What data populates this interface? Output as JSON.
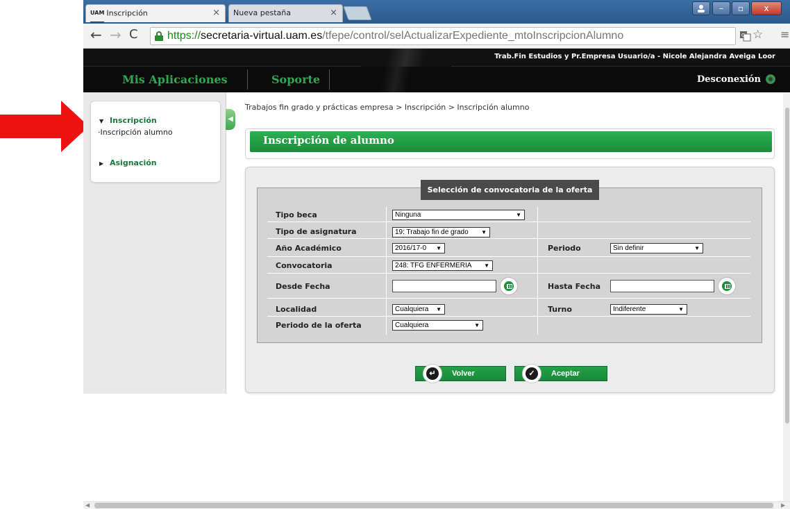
{
  "browser": {
    "tabs": [
      {
        "favicon": "UAM",
        "label": "Inscripción",
        "active": true
      },
      {
        "label": "Nueva pestaña",
        "active": false
      }
    ],
    "url": {
      "protocol": "https://",
      "host": "secretaria-virtual.uam.es",
      "path": "/tfepe/control/selActualizarExpediente_mtoInscripcionAlumno"
    },
    "close_glyph": "×",
    "window_buttons": {
      "minimize": "–",
      "maximize": "▫",
      "close": "x"
    }
  },
  "header": {
    "info": "Trab.Fin Estudios y Pr.Empresa  Usuario/a - Nicole Alejandra Aveiga Loor",
    "menu": {
      "apps": "Mis Aplicaciones",
      "support": "Soporte"
    },
    "logout": "Desconexión"
  },
  "sidebar": {
    "groups": [
      {
        "label": "Inscripción",
        "expanded": true,
        "items": [
          "Inscripción alumno"
        ]
      },
      {
        "label": "Asignación",
        "expanded": false,
        "items": []
      }
    ],
    "bullet": "·"
  },
  "main": {
    "breadcrumb": "Trabajos fin grado y prácticas empresa > Inscripción > Inscripción alumno",
    "title": "Inscripción de alumno",
    "fieldset_legend": "Selección de convocatoria de la oferta",
    "fields": {
      "tipo_beca": {
        "label": "Tipo beca",
        "value": "Ninguna"
      },
      "tipo_asignatura": {
        "label": "Tipo de asignatura",
        "value": "19: Trabajo fin de grado"
      },
      "anio_academico": {
        "label": "Año Académico",
        "value": "2016/17-0"
      },
      "periodo": {
        "label": "Periodo",
        "value": "Sin definir"
      },
      "convocatoria": {
        "label": "Convocatoria",
        "value": "248: TFG ENFERMERIA"
      },
      "desde_fecha": {
        "label": "Desde Fecha",
        "value": ""
      },
      "hasta_fecha": {
        "label": "Hasta Fecha",
        "value": ""
      },
      "localidad": {
        "label": "Localidad",
        "value": "Cualquiera"
      },
      "turno": {
        "label": "Turno",
        "value": "Indiferente"
      },
      "periodo_oferta": {
        "label": "Periodo de la oferta",
        "value": "Cualquiera"
      }
    },
    "buttons": {
      "back": "Volver",
      "accept": "Aceptar"
    }
  },
  "colors": {
    "brand_green": "#1a8c3a",
    "annotation_red": "#ee1111",
    "header_black": "#0b0b0b"
  },
  "icons": [
    "back-icon",
    "forward-icon",
    "reload-icon",
    "lock-icon",
    "translate-icon",
    "star-icon",
    "menu-icon",
    "power-icon",
    "calendar-icon",
    "return-icon",
    "check-icon",
    "red-arrow-annotation"
  ]
}
